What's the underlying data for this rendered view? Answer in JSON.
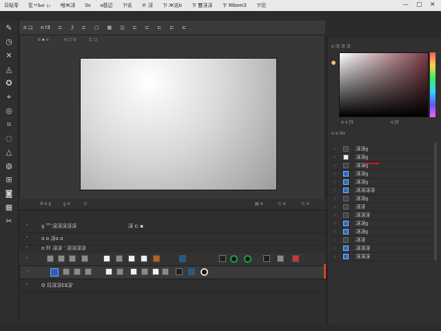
{
  "menu": {
    "items": [
      "ㄖ砧苓",
      "乭ㄲЪo ぃ",
      "咁Ж冴",
      "0ν",
      "ᵾ苣辺",
      "ㄗ讬",
      "℗ 冴 ",
      "ㄗ Ж讬b",
      "ㄗ 雙冴冴",
      "ㄗ ЯIbeei3",
      "ㄗ汜"
    ],
    "window_controls": [
      "—",
      "▢",
      "✕"
    ]
  },
  "options_bar": {
    "items": [
      "ɑ ❏",
      "ɑ tƎ",
      "⊏",
      "ℨ",
      "⊏",
      "▢",
      "▦",
      "◫",
      "⊏",
      "⊏",
      "⊏",
      "⊏",
      "⊏"
    ]
  },
  "document": {
    "info_left": "ɑ ▪ ɑ",
    "info_mid1": "ɑ ▢ ɑ",
    "info_mid2": "⊏ ▢"
  },
  "status": {
    "left": [
      "Ə ɑ ƍ",
      "ƍ ɑ",
      "⊏"
    ],
    "right": [
      "▤ ɑ",
      "⊏ ɑ",
      "⊏ ɑ"
    ]
  },
  "timeline": {
    "rows": [
      {
        "label": "ƍ 爫ʼ冴冴冴冴冴",
        "mid": "冴 ⊏ ▪"
      },
      {
        "label": "ɑ ɑ 冴ɑ ɑ"
      },
      {
        "label": "ɑ 幵 冴冴 ʼ 冴冴冴冴"
      },
      {
        "label": ""
      },
      {
        "label": ""
      },
      {
        "label": "ʘ ㄖ冴冴ΣƎ冴ʼ"
      }
    ]
  },
  "color_panel": {
    "title": "ɑ 冴 冴 冴",
    "hex_left": "ɑ ɑ ʃƎ",
    "hex_right": "ɑ ʃƎ"
  },
  "layers": {
    "header": "ɑ ɑ Əɑ",
    "items": [
      "冴冴ƍ",
      "冴冴ƍ",
      "冴冴ƍ",
      "冴冴ƍ",
      "冴冴ƍ",
      "冴冴冴冴",
      "冴冴ƍ",
      "冴冴",
      "冴冴冴",
      "冴冴ƍ",
      "冴冴ƍ",
      "冴冴",
      "冴冴冴",
      "冴冴冴"
    ]
  },
  "colors": {
    "accent_orange": "#c05d1e",
    "accent_green": "#1ea14a",
    "accent_red": "#d21a1a",
    "accent_blue": "#2a5fb8"
  }
}
